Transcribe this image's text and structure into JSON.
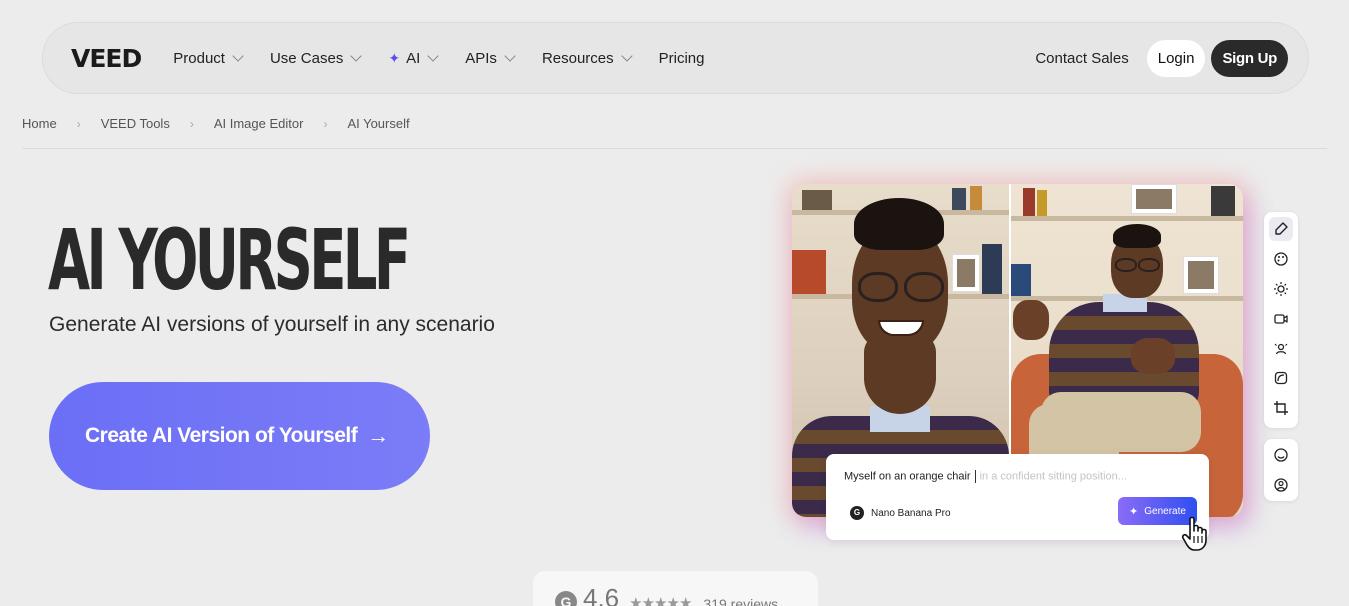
{
  "nav": {
    "logo": "VEED",
    "items": [
      {
        "label": "Product"
      },
      {
        "label": "Use Cases"
      },
      {
        "label": "AI"
      },
      {
        "label": "APIs"
      },
      {
        "label": "Resources"
      },
      {
        "label": "Pricing"
      }
    ],
    "contact": "Contact Sales",
    "login": "Login",
    "signup": "Sign Up"
  },
  "breadcrumb": [
    "Home",
    "VEED Tools",
    "AI Image Editor",
    "AI Yourself"
  ],
  "hero": {
    "title": "AI YOURSELF",
    "subtitle": "Generate AI versions of yourself in any scenario",
    "cta": "Create AI Version of Yourself"
  },
  "prompt": {
    "text": "Myself on an orange chair",
    "placeholder": "in a confident sitting position...",
    "model": "Nano Banana Pro",
    "generate": "Generate"
  },
  "toolbar_icons": [
    "brush-icon",
    "palette-icon",
    "sun-icon",
    "video-icon",
    "person-icon",
    "layers-icon",
    "crop-icon",
    "smile-icon",
    "user-circle-icon"
  ],
  "rating": {
    "score": "4.6",
    "stars": "★★★★★",
    "reviews": "319 reviews",
    "level": 0.92
  },
  "colors": {
    "cta": "#6b6ff6",
    "accent": "#5b4cf5",
    "signup": "#2a2a2a"
  }
}
